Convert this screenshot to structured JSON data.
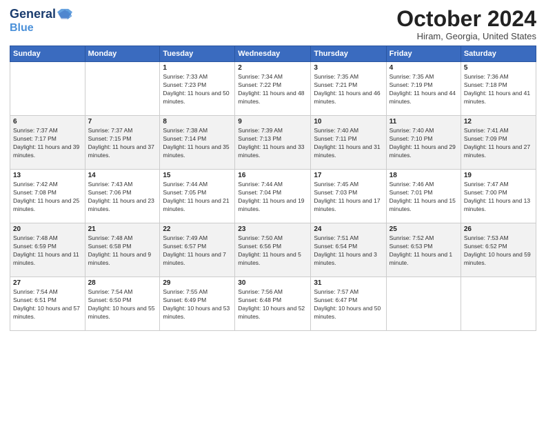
{
  "header": {
    "logo_line1": "General",
    "logo_line2": "Blue",
    "month_title": "October 2024",
    "location": "Hiram, Georgia, United States"
  },
  "days_of_week": [
    "Sunday",
    "Monday",
    "Tuesday",
    "Wednesday",
    "Thursday",
    "Friday",
    "Saturday"
  ],
  "weeks": [
    [
      {
        "day": "",
        "detail": ""
      },
      {
        "day": "",
        "detail": ""
      },
      {
        "day": "1",
        "detail": "Sunrise: 7:33 AM\nSunset: 7:23 PM\nDaylight: 11 hours and 50 minutes."
      },
      {
        "day": "2",
        "detail": "Sunrise: 7:34 AM\nSunset: 7:22 PM\nDaylight: 11 hours and 48 minutes."
      },
      {
        "day": "3",
        "detail": "Sunrise: 7:35 AM\nSunset: 7:21 PM\nDaylight: 11 hours and 46 minutes."
      },
      {
        "day": "4",
        "detail": "Sunrise: 7:35 AM\nSunset: 7:19 PM\nDaylight: 11 hours and 44 minutes."
      },
      {
        "day": "5",
        "detail": "Sunrise: 7:36 AM\nSunset: 7:18 PM\nDaylight: 11 hours and 41 minutes."
      }
    ],
    [
      {
        "day": "6",
        "detail": "Sunrise: 7:37 AM\nSunset: 7:17 PM\nDaylight: 11 hours and 39 minutes."
      },
      {
        "day": "7",
        "detail": "Sunrise: 7:37 AM\nSunset: 7:15 PM\nDaylight: 11 hours and 37 minutes."
      },
      {
        "day": "8",
        "detail": "Sunrise: 7:38 AM\nSunset: 7:14 PM\nDaylight: 11 hours and 35 minutes."
      },
      {
        "day": "9",
        "detail": "Sunrise: 7:39 AM\nSunset: 7:13 PM\nDaylight: 11 hours and 33 minutes."
      },
      {
        "day": "10",
        "detail": "Sunrise: 7:40 AM\nSunset: 7:11 PM\nDaylight: 11 hours and 31 minutes."
      },
      {
        "day": "11",
        "detail": "Sunrise: 7:40 AM\nSunset: 7:10 PM\nDaylight: 11 hours and 29 minutes."
      },
      {
        "day": "12",
        "detail": "Sunrise: 7:41 AM\nSunset: 7:09 PM\nDaylight: 11 hours and 27 minutes."
      }
    ],
    [
      {
        "day": "13",
        "detail": "Sunrise: 7:42 AM\nSunset: 7:08 PM\nDaylight: 11 hours and 25 minutes."
      },
      {
        "day": "14",
        "detail": "Sunrise: 7:43 AM\nSunset: 7:06 PM\nDaylight: 11 hours and 23 minutes."
      },
      {
        "day": "15",
        "detail": "Sunrise: 7:44 AM\nSunset: 7:05 PM\nDaylight: 11 hours and 21 minutes."
      },
      {
        "day": "16",
        "detail": "Sunrise: 7:44 AM\nSunset: 7:04 PM\nDaylight: 11 hours and 19 minutes."
      },
      {
        "day": "17",
        "detail": "Sunrise: 7:45 AM\nSunset: 7:03 PM\nDaylight: 11 hours and 17 minutes."
      },
      {
        "day": "18",
        "detail": "Sunrise: 7:46 AM\nSunset: 7:01 PM\nDaylight: 11 hours and 15 minutes."
      },
      {
        "day": "19",
        "detail": "Sunrise: 7:47 AM\nSunset: 7:00 PM\nDaylight: 11 hours and 13 minutes."
      }
    ],
    [
      {
        "day": "20",
        "detail": "Sunrise: 7:48 AM\nSunset: 6:59 PM\nDaylight: 11 hours and 11 minutes."
      },
      {
        "day": "21",
        "detail": "Sunrise: 7:48 AM\nSunset: 6:58 PM\nDaylight: 11 hours and 9 minutes."
      },
      {
        "day": "22",
        "detail": "Sunrise: 7:49 AM\nSunset: 6:57 PM\nDaylight: 11 hours and 7 minutes."
      },
      {
        "day": "23",
        "detail": "Sunrise: 7:50 AM\nSunset: 6:56 PM\nDaylight: 11 hours and 5 minutes."
      },
      {
        "day": "24",
        "detail": "Sunrise: 7:51 AM\nSunset: 6:54 PM\nDaylight: 11 hours and 3 minutes."
      },
      {
        "day": "25",
        "detail": "Sunrise: 7:52 AM\nSunset: 6:53 PM\nDaylight: 11 hours and 1 minute."
      },
      {
        "day": "26",
        "detail": "Sunrise: 7:53 AM\nSunset: 6:52 PM\nDaylight: 10 hours and 59 minutes."
      }
    ],
    [
      {
        "day": "27",
        "detail": "Sunrise: 7:54 AM\nSunset: 6:51 PM\nDaylight: 10 hours and 57 minutes."
      },
      {
        "day": "28",
        "detail": "Sunrise: 7:54 AM\nSunset: 6:50 PM\nDaylight: 10 hours and 55 minutes."
      },
      {
        "day": "29",
        "detail": "Sunrise: 7:55 AM\nSunset: 6:49 PM\nDaylight: 10 hours and 53 minutes."
      },
      {
        "day": "30",
        "detail": "Sunrise: 7:56 AM\nSunset: 6:48 PM\nDaylight: 10 hours and 52 minutes."
      },
      {
        "day": "31",
        "detail": "Sunrise: 7:57 AM\nSunset: 6:47 PM\nDaylight: 10 hours and 50 minutes."
      },
      {
        "day": "",
        "detail": ""
      },
      {
        "day": "",
        "detail": ""
      }
    ]
  ]
}
